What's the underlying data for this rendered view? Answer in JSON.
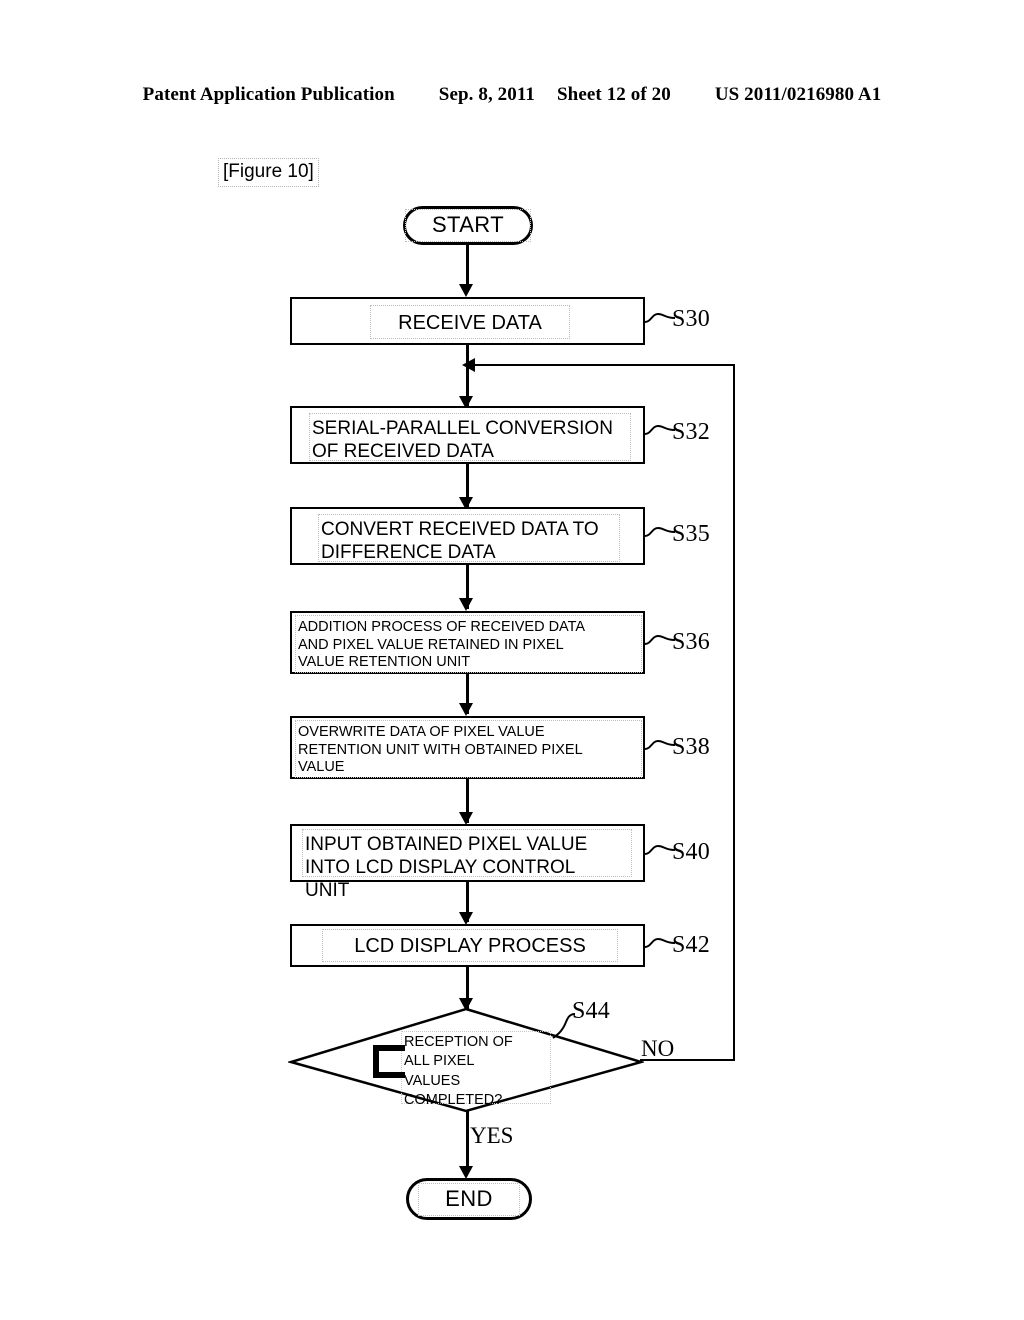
{
  "header": {
    "publication": "Patent Application Publication",
    "date": "Sep. 8, 2011",
    "sheet": "Sheet 12 of 20",
    "patent_number": "US 2011/0216980 A1"
  },
  "figure": {
    "label": "[Figure 10]"
  },
  "flowchart": {
    "start": {
      "label": "START",
      "ref": ""
    },
    "end": {
      "label": "END",
      "ref": ""
    },
    "steps": [
      {
        "ref": "S30",
        "text": "RECEIVE DATA",
        "align": "center"
      },
      {
        "ref": "S32",
        "text": "SERIAL-PARALLEL CONVERSION\nOF RECEIVED DATA",
        "align": "left"
      },
      {
        "ref": "S35",
        "text": "CONVERT RECEIVED DATA TO\nDIFFERENCE DATA",
        "align": "left"
      },
      {
        "ref": "S36",
        "text": "ADDITION PROCESS OF RECEIVED DATA\nAND PIXEL VALUE RETAINED IN PIXEL\nVALUE RETENTION UNIT",
        "align": "left"
      },
      {
        "ref": "S38",
        "text": "OVERWRITE DATA OF PIXEL VALUE\nRETENTION UNIT WITH OBTAINED PIXEL\nVALUE",
        "align": "left"
      },
      {
        "ref": "S40",
        "text": "INPUT OBTAINED PIXEL VALUE\nINTO LCD DISPLAY CONTROL\nUNIT",
        "align": "left"
      },
      {
        "ref": "S42",
        "text": "LCD DISPLAY PROCESS",
        "align": "center"
      }
    ],
    "decision": {
      "ref": "S44",
      "text": "RECEPTION OF\nALL PIXEL\nVALUES\nCOMPLETED?",
      "yes_label": "YES",
      "no_label": "NO"
    }
  }
}
